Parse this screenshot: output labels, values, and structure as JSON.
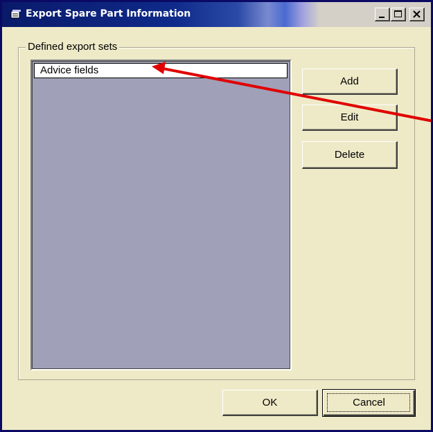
{
  "window": {
    "title": "Export Spare Part Information",
    "controls": {
      "minimize": "minimize-icon",
      "maximize": "maximize-icon",
      "close": "close-icon"
    }
  },
  "group": {
    "legend": "Defined export sets"
  },
  "export_sets": {
    "items": [
      "Advice fields"
    ],
    "selected": "Advice fields"
  },
  "actions": {
    "add_label": "Add",
    "edit_label": "Edit",
    "delete_label": "Delete"
  },
  "footer": {
    "ok_label": "OK",
    "cancel_label": "Cancel"
  },
  "annotation": {
    "arrow_color": "#e00000"
  },
  "colors": {
    "titlebar": "#0a1a6a",
    "dialog_bg": "#eeeac8",
    "list_bg": "#a0a0b8"
  }
}
